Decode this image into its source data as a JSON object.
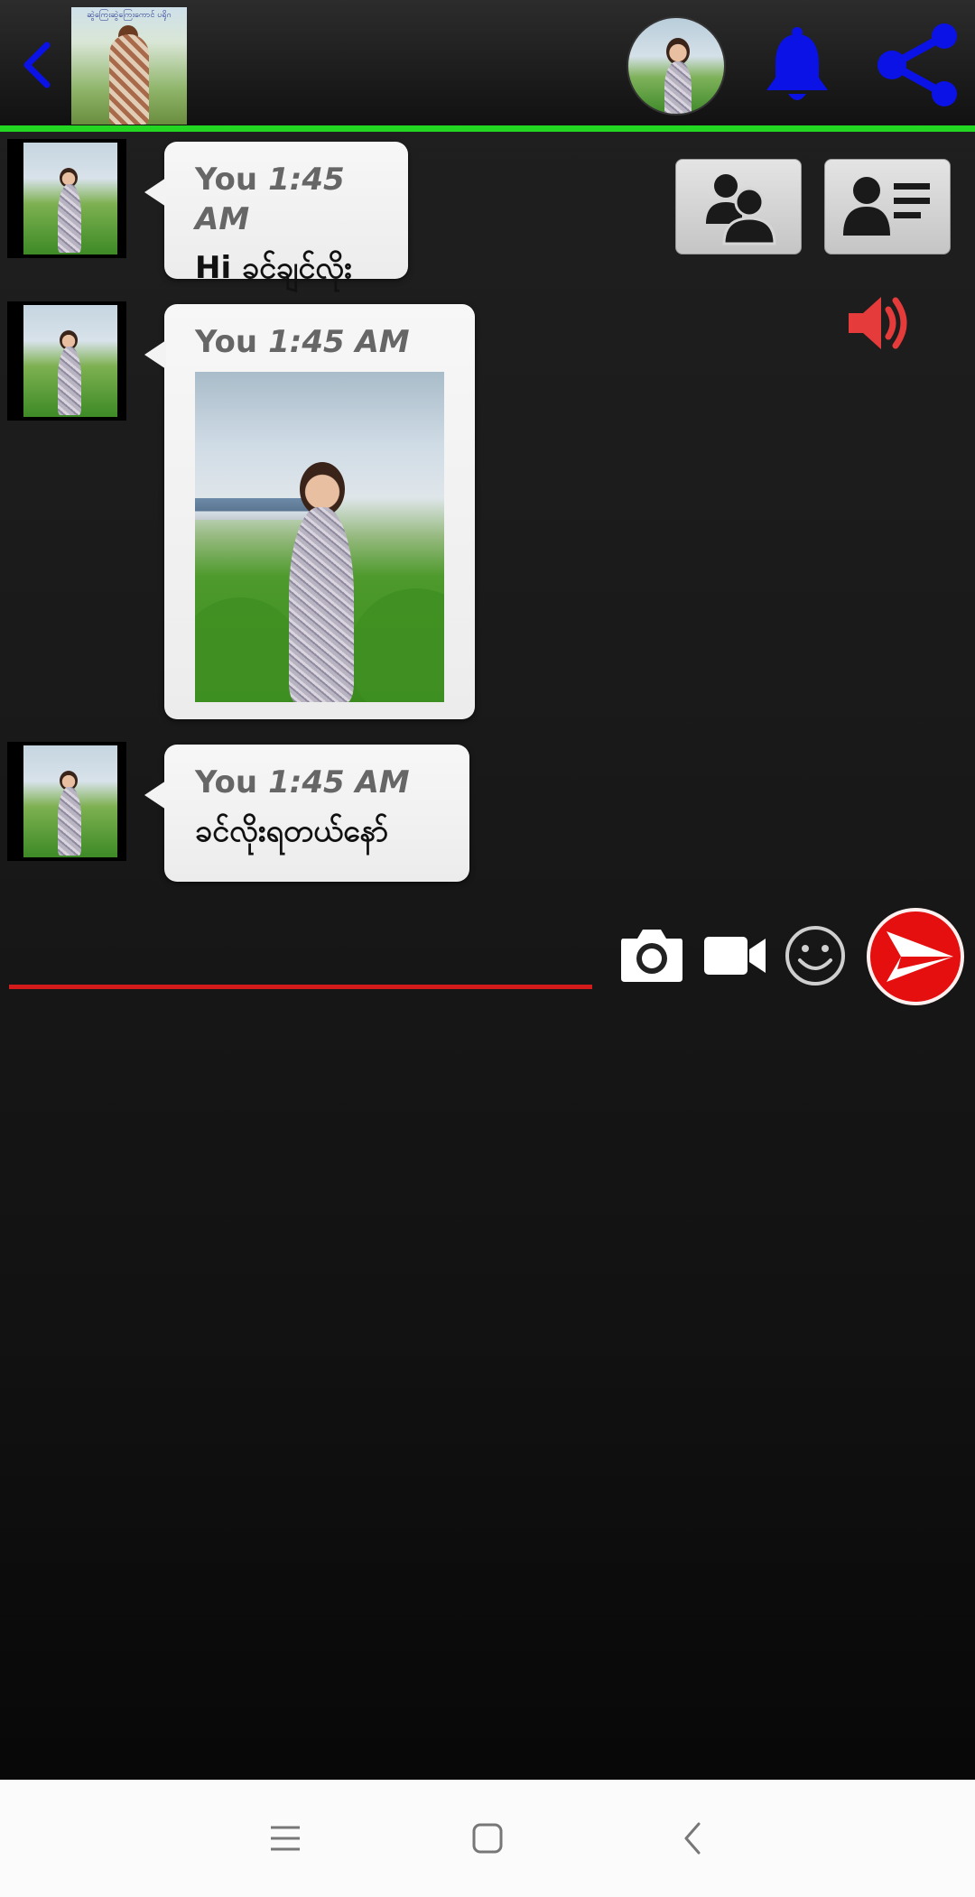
{
  "header": {
    "back_icon": "chevron-left-icon",
    "thumb_caption": "ဆွဲကြေးဆွဲကြေးကောင် ပရိုဂ",
    "bell_icon": "bell-icon",
    "share_icon": "share-icon",
    "accent_color": "#0a12e6",
    "divider_color": "#22d622"
  },
  "actions": {
    "friends_icon": "users-icon",
    "profile_icon": "user-card-icon",
    "speaker_icon": "speaker-icon",
    "speaker_color": "#e63b3b"
  },
  "messages": [
    {
      "sender": "You",
      "time": "1:45 AM",
      "text": "Hi ခင်ချင်လိုး"
    },
    {
      "sender": "You",
      "time": "1:45 AM",
      "text": "",
      "has_image": true
    },
    {
      "sender": "You",
      "time": "1:45 AM",
      "text": "ခင်လိုးရတယ်နော်"
    }
  ],
  "composer": {
    "placeholder": "",
    "value": "",
    "camera_icon": "camera-icon",
    "video_icon": "video-camera-icon",
    "emoji_icon": "smiley-icon",
    "send_icon": "send-icon",
    "send_color": "#e50f0f"
  },
  "navbar": {
    "menu_icon": "menu-icon",
    "home_icon": "home-square-icon",
    "back_icon": "back-chevron-icon"
  }
}
